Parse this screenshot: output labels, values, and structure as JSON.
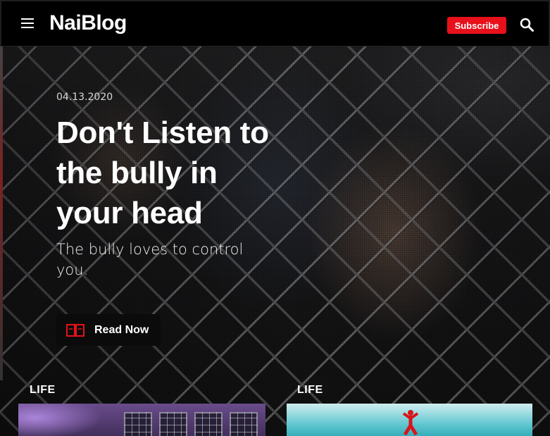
{
  "header": {
    "logo": "NaiBlog",
    "subscribe_label": "Subscribe",
    "menu_icon": "hamburger-menu-icon",
    "search_icon": "search-icon"
  },
  "hero": {
    "date": "04.13.2020",
    "title": "Don't Listen to the bully in your head",
    "subtitle": "The bully loves to control you.",
    "cta_label": "Read Now",
    "cta_icon": "open-book-icon"
  },
  "cards": [
    {
      "category": "LIFE"
    },
    {
      "category": "LIFE"
    }
  ],
  "colors": {
    "accent": "#e8101a",
    "header_bg": "#000000",
    "cta_bg": "#0b0b0b"
  }
}
